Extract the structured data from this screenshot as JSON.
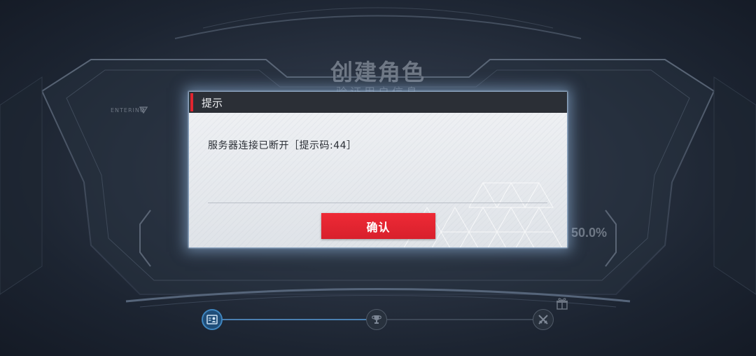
{
  "background": {
    "title": "创建角色",
    "subtitle": "验证用户信息",
    "entering_label": "ENTERING",
    "progress_text": "50.0%",
    "nav_icons": [
      "profile-card-icon",
      "trophy-icon",
      "crossed-swords-icon"
    ],
    "gift_icon": "gift-icon"
  },
  "dialog": {
    "title": "提示",
    "message": "服务器连接已断开［提示码:44］",
    "confirm_label": "确认"
  },
  "colors": {
    "accent_red": "#e0252f",
    "dialog_header": "#2b2f36",
    "dialog_body": "#eef0f3",
    "active_nav": "#1f4d78"
  }
}
